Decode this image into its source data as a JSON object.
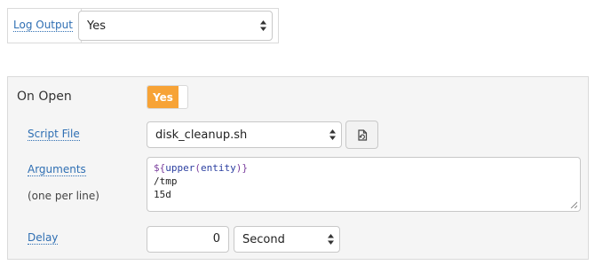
{
  "log_output": {
    "label": "Log Output",
    "value": "Yes"
  },
  "on_open": {
    "label": "On Open",
    "toggle_label": "Yes",
    "script_file": {
      "label": "Script File",
      "value": "disk_cleanup.sh",
      "file_icon": "file-refresh-icon"
    },
    "arguments": {
      "label": "Arguments",
      "hint": "(one per line)",
      "line1_prefix": "${",
      "line1_fn": "upper",
      "line1_open": "(",
      "line1_arg": "entity",
      "line1_close": ")}",
      "line2": "/tmp",
      "line3": "15d"
    },
    "delay": {
      "label": "Delay",
      "value": "0",
      "unit": "Second"
    }
  },
  "colors": {
    "link": "#2f6fb3",
    "toggle_on": "#f7a336",
    "panel_bg": "#f5f5f5"
  }
}
